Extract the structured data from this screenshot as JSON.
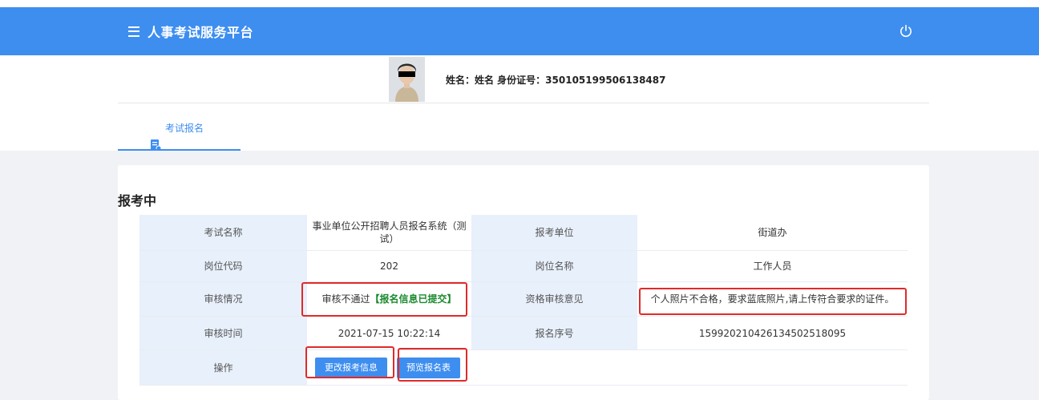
{
  "header": {
    "title": "人事考试服务平台",
    "menu_icon": "menu-icon",
    "power_icon": "power-icon",
    "bg_color": "#3e8ef0"
  },
  "user": {
    "info": "姓名：姓名 身份证号：350105199506138487",
    "photo_icon": "avatar-photo"
  },
  "tabs": [
    {
      "label": "考试报名",
      "icon": "document-icon",
      "active": true
    }
  ],
  "section": {
    "title": "报考中"
  },
  "table": {
    "rows": [
      {
        "label1": "考试名称",
        "value1": "事业单位公开招聘人员报名系统（测试）",
        "label2": "报考单位",
        "value2": "街道办"
      },
      {
        "label1": "岗位代码",
        "value1": "202",
        "label2": "岗位名称",
        "value2": "工作人员"
      },
      {
        "label1": "审核情况",
        "value1_status": "审核不通过",
        "value1_note": "【报名信息已提交】",
        "label2": "资格审核意见",
        "value2": "个人照片不合格，要求蓝底照片,请上传符合要求的证件。"
      },
      {
        "label1": "审核时间",
        "value1": "2021-07-15 10:22:14",
        "label2": "报名序号",
        "value2": "15992021042613450251809​5"
      },
      {
        "label1": "操作"
      }
    ]
  },
  "actions": {
    "edit_label": "更改报考信息",
    "preview_label": "预览报名表"
  },
  "colors": {
    "accent": "#3e8ef0",
    "success_text": "#1a8a2e",
    "highlight_border": "#e02a2a",
    "label_bg": "#e8f0fb"
  }
}
